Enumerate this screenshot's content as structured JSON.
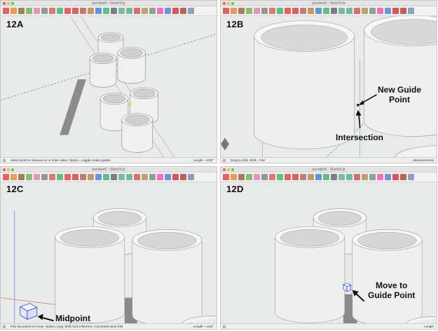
{
  "panels": {
    "a": {
      "label": "12A",
      "window_title": "pendant6 - SketchUp",
      "status_left": "Select point to measure to or enter value.  Option = toggle create guides.",
      "status_right": "Length  ~ 4/32\""
    },
    "b": {
      "label": "12B",
      "window_title": "pendant6 - SketchUp",
      "status_left": "Drag to orbit. Shift = Pan",
      "status_right": "Measurements",
      "callout_new": [
        "New Guide",
        "Point"
      ],
      "callout_intersection": "Intersection"
    },
    "c": {
      "label": "12C",
      "window_title": "pendant6 - SketchUp",
      "status_left": "Pick two points to move.  Option=copy, Shift=lock inference, Command=auto-fold",
      "status_right": "Length  ~ 1/64\"",
      "callout_midpoint": "Midpoint"
    },
    "d": {
      "label": "12D",
      "window_title": "pendant6 - SketchUp",
      "status_left": "",
      "status_right": "Length",
      "callout_move": [
        "Move to",
        "Guide Point"
      ]
    }
  },
  "toolbar_icons": [
    "select-icon",
    "pencil-icon",
    "rectangle-icon",
    "circle-icon",
    "eraser-icon",
    "tape-measure-icon",
    "paint-bucket-icon",
    "push-pull-icon",
    "move-icon",
    "rotate-icon",
    "scale-icon",
    "offset-icon",
    "orbit-icon",
    "pan-icon",
    "zoom-icon",
    "zoom-extents-icon",
    "camera-icon",
    "position-icon",
    "section-icon",
    "walk-icon",
    "components-icon",
    "warehouse-icon",
    "extension-icon",
    "ruby-icon",
    "info-icon"
  ],
  "colors": {
    "background": "#e9eaea",
    "cylinder": "#f2f2f2",
    "cylinder_shade": "#cfcfcf",
    "axis_green": "#3a9d3a",
    "axis_red": "#c0392b",
    "axis_blue": "#2d4bbf"
  }
}
